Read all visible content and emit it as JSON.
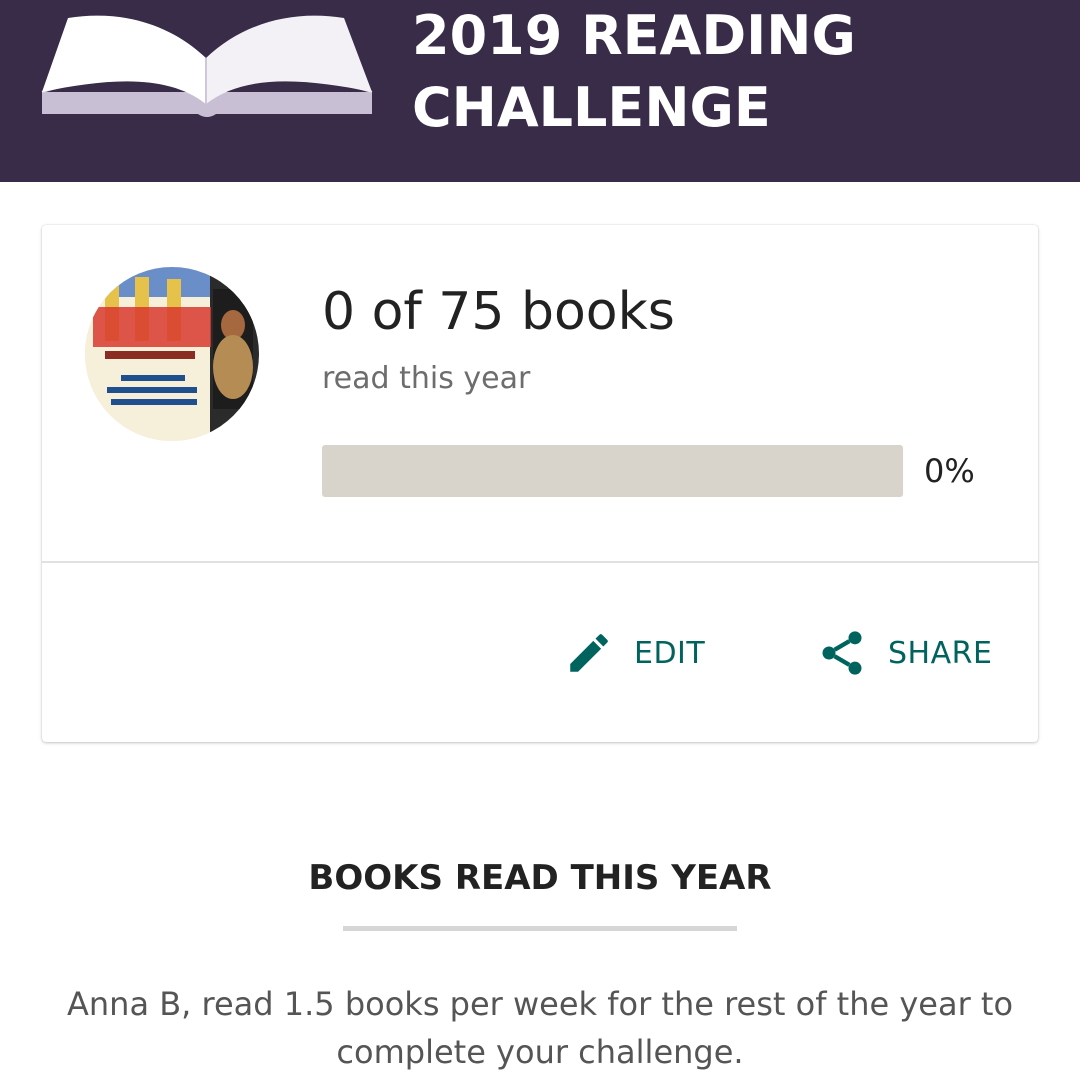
{
  "header": {
    "title_line1": "2019 READING",
    "title_line2": "CHALLENGE",
    "background_color": "#382c49",
    "icon": "open-book-icon"
  },
  "challenge_card": {
    "avatar": "user-avatar-photo",
    "count_text": "0 of 75 books",
    "subtitle": "read this year",
    "progress_fraction": 0,
    "percent_text": "0%",
    "actions": {
      "edit_label": "EDIT",
      "edit_icon": "pencil-icon",
      "share_label": "SHARE",
      "share_icon": "share-icon",
      "color": "#00635d"
    }
  },
  "books_section": {
    "heading": "BOOKS READ THIS YEAR",
    "pace_text": "Anna B, read 1.5 books per week for the rest of the year to complete your challenge."
  }
}
